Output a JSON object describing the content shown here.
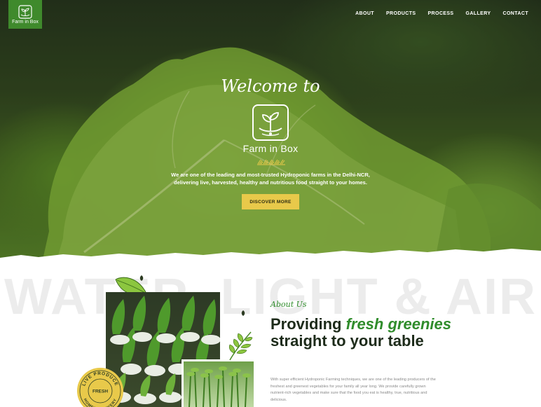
{
  "header": {
    "logo_text": "Farm in Box",
    "nav": [
      {
        "label": "ABOUT"
      },
      {
        "label": "PRODUCTS"
      },
      {
        "label": "PROCESS"
      },
      {
        "label": "GALLERY"
      },
      {
        "label": "CONTACT"
      }
    ]
  },
  "hero": {
    "welcome": "Welcome to",
    "brand": "Farm in Box",
    "line1": "We are one of the leading and most-trusted Hydroponic farms in the Delhi-NCR,",
    "line2": "delivering live, harvested, healthy and nutritious food straight to your homes.",
    "cta_label": "DISCOVER MORE"
  },
  "about": {
    "watermark": "WATER, LIGHT & AIR",
    "label": "About Us",
    "title_part1": "Providing ",
    "title_accent1": "fresh",
    "title_accent2": "greenies",
    "title_part2": " straight to your table",
    "body": "With super efficient Hydroponic Farming techniques, we are one of the leading producers of the freshest and greenest vegetables for your family all year long. We provide carefully grown nutrient-rich vegetables and make sure that the food you eat is healthy, true, nutritious and delicious.",
    "stamp_top": "LIVE PRODUCE",
    "stamp_center": "FRESH",
    "stamp_bottom": "HOMES DELIVERY"
  },
  "colors": {
    "brand_green": "#3f8a2c",
    "accent_yellow": "#e8c94a",
    "heading_dark": "#1d2b1a",
    "accent_green": "#2f8c2b"
  },
  "icons": [
    "logo-plant-icon",
    "plant-in-box-icon",
    "wheat-divider-icon",
    "leaf-icon"
  ]
}
